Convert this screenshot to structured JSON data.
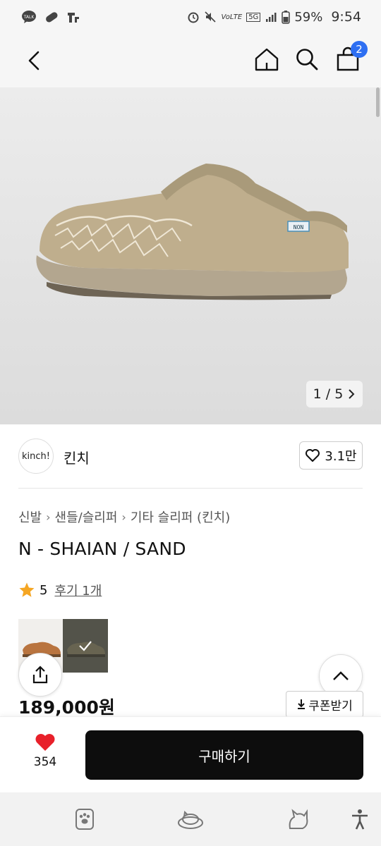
{
  "status_bar": {
    "battery": "59%",
    "time": "9:54",
    "network_label": "5G",
    "volte_label": "VoLTE"
  },
  "header": {
    "cart_count": "2"
  },
  "gallery": {
    "page_label": "1 / 5",
    "badge_text": "NON"
  },
  "shop": {
    "avatar_text": "kinch!",
    "name": "킨치",
    "likes": "3.1만"
  },
  "breadcrumb": [
    "신발",
    "샌들/슬리퍼",
    "기타 슬리퍼 (킨치)"
  ],
  "product": {
    "title": "N - SHAIAN / SAND",
    "rating": "5",
    "review_link": "후기 1개",
    "price": "189,000원",
    "coupon_label": "쿠폰받기"
  },
  "purchase": {
    "wish_count": "354",
    "buy_label": "구매하기"
  },
  "colors": {
    "accent_blue": "#2e6ff2",
    "heart_red": "#e8202a",
    "star": "#f5a623",
    "buy_button": "#0d0d0d"
  }
}
